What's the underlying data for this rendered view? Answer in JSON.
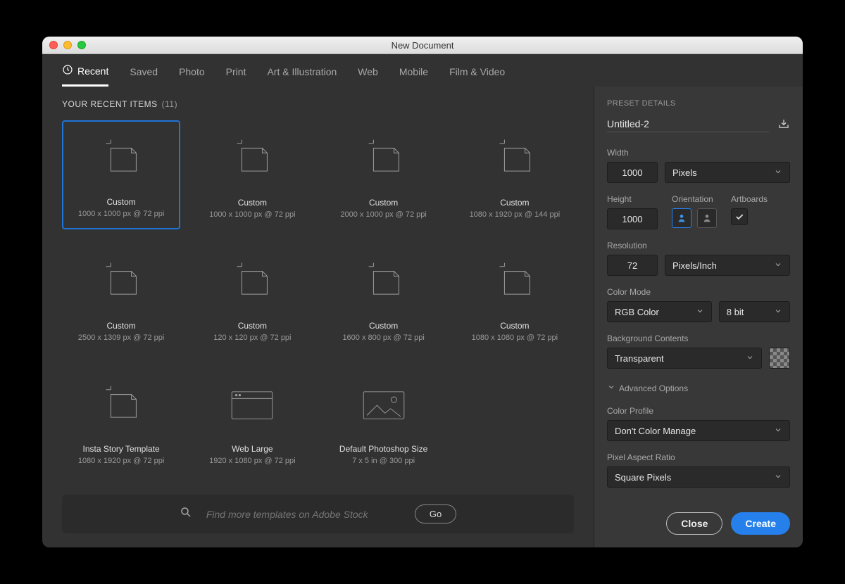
{
  "window": {
    "title": "New Document"
  },
  "tabs": [
    {
      "id": "recent",
      "label": "Recent",
      "active": true
    },
    {
      "id": "saved",
      "label": "Saved"
    },
    {
      "id": "photo",
      "label": "Photo"
    },
    {
      "id": "print",
      "label": "Print"
    },
    {
      "id": "art",
      "label": "Art & Illustration"
    },
    {
      "id": "web",
      "label": "Web"
    },
    {
      "id": "mobile",
      "label": "Mobile"
    },
    {
      "id": "film",
      "label": "Film & Video"
    }
  ],
  "gallery": {
    "heading": "YOUR RECENT ITEMS",
    "count_label": "(11)",
    "items": [
      {
        "title": "Custom",
        "subtitle": "1000 x 1000 px @ 72 ppi",
        "icon": "doc",
        "selected": true
      },
      {
        "title": "Custom",
        "subtitle": "1000 x 1000 px @ 72 ppi",
        "icon": "doc"
      },
      {
        "title": "Custom",
        "subtitle": "2000 x 1000 px @ 72 ppi",
        "icon": "doc"
      },
      {
        "title": "Custom",
        "subtitle": "1080 x 1920 px @ 144 ppi",
        "icon": "doc"
      },
      {
        "title": "Custom",
        "subtitle": "2500 x 1309 px @ 72 ppi",
        "icon": "doc"
      },
      {
        "title": "Custom",
        "subtitle": "120 x 120 px @ 72 ppi",
        "icon": "doc"
      },
      {
        "title": "Custom",
        "subtitle": "1600 x 800 px @ 72 ppi",
        "icon": "doc"
      },
      {
        "title": "Custom",
        "subtitle": "1080 x 1080 px @ 72 ppi",
        "icon": "doc"
      },
      {
        "title": "Insta Story Template",
        "subtitle": "1080 x 1920 px @ 72 ppi",
        "icon": "doc"
      },
      {
        "title": "Web Large",
        "subtitle": "1920 x 1080 px @ 72 ppi",
        "icon": "browser"
      },
      {
        "title": "Default Photoshop Size",
        "subtitle": "7 x 5 in @ 300 ppi",
        "icon": "image"
      }
    ],
    "stock": {
      "placeholder": "Find more templates on Adobe Stock",
      "go_label": "Go"
    }
  },
  "preset": {
    "heading": "PRESET DETAILS",
    "doc_name": "Untitled-2",
    "width_label": "Width",
    "width_value": "1000",
    "width_unit": "Pixels",
    "height_label": "Height",
    "height_value": "1000",
    "orientation_label": "Orientation",
    "artboards_label": "Artboards",
    "artboards_checked": true,
    "resolution_label": "Resolution",
    "resolution_value": "72",
    "resolution_unit": "Pixels/Inch",
    "color_mode_label": "Color Mode",
    "color_mode": "RGB Color",
    "color_depth": "8 bit",
    "bg_label": "Background Contents",
    "bg_value": "Transparent",
    "advanced_label": "Advanced Options",
    "color_profile_label": "Color Profile",
    "color_profile": "Don't Color Manage",
    "pixel_aspect_label": "Pixel Aspect Ratio",
    "pixel_aspect": "Square Pixels"
  },
  "footer": {
    "close": "Close",
    "create": "Create"
  }
}
